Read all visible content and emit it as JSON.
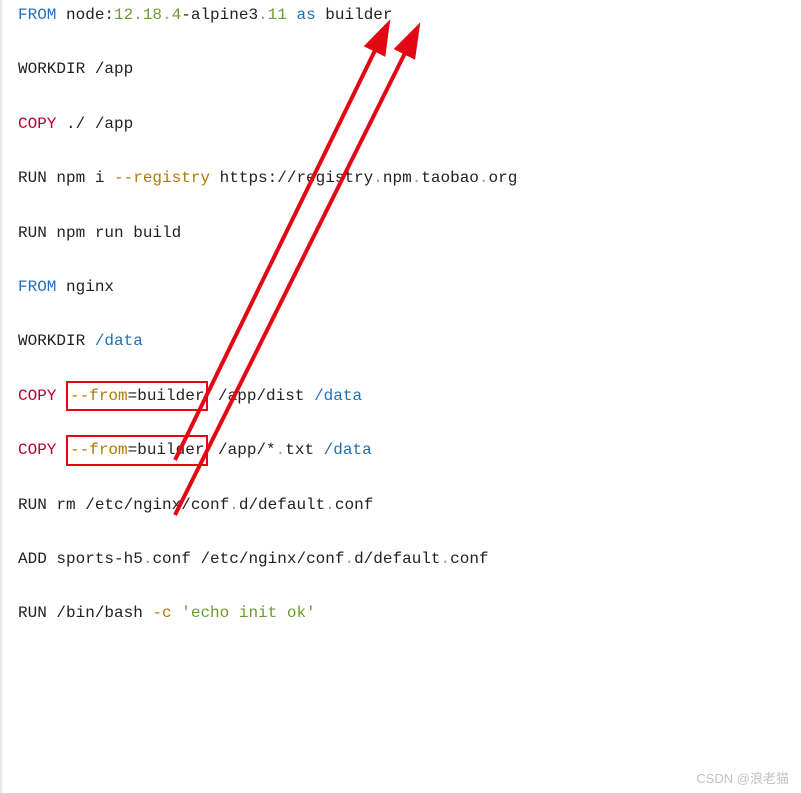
{
  "lines": {
    "l1_from": "FROM",
    "l1_node": " node:",
    "l1_v1": "12",
    "l1_d": ".",
    "l1_v2": "18",
    "l1_v3": "4",
    "l1_alp": "-alpine3",
    "l1_v4": "11",
    "l1_as": " as",
    "l1_builder": " builder",
    "l2": "WORKDIR /app",
    "l3_copy": "COPY",
    "l3_rest": " ./ /app",
    "l4_run": "RUN npm i ",
    "l4_flag": "--registry",
    "l4_url1": " https://registry",
    "l4_url2": "npm",
    "l4_url3": "taobao",
    "l4_url4": "org",
    "l5": "RUN npm run build",
    "l6_from": "FROM",
    "l6_nginx": " nginx",
    "l7_wd": "WORKDIR ",
    "l7_data": "/data",
    "l8_copy": "COPY",
    "l8_sp1": " ",
    "l8_flag": "--from",
    "l8_eq": "=builder",
    "l8_mid": " /app/dist ",
    "l8_data": "/data",
    "l9_copy": "COPY",
    "l9_sp1": " ",
    "l9_flag": "--from",
    "l9_eq": "=builder",
    "l9_mid": " /app/*",
    "l9_txt": "txt ",
    "l9_data": "/data",
    "l10_run": "RUN rm /etc/nginx/conf",
    "l10_b": "d/default",
    "l10_c": "conf",
    "l11_add": "ADD sports-h5",
    "l11_b": "conf /etc/nginx/conf",
    "l11_c": "d/default",
    "l11_d": "conf",
    "l12_run": "RUN /bin/bash ",
    "l12_flag": "-c",
    "l12_sp": " ",
    "l12_str": "'echo init ok'"
  },
  "watermark": "CSDN @浪老猫",
  "annotations": {
    "arrow_color": "#e30613",
    "box_color": "#e30613"
  }
}
